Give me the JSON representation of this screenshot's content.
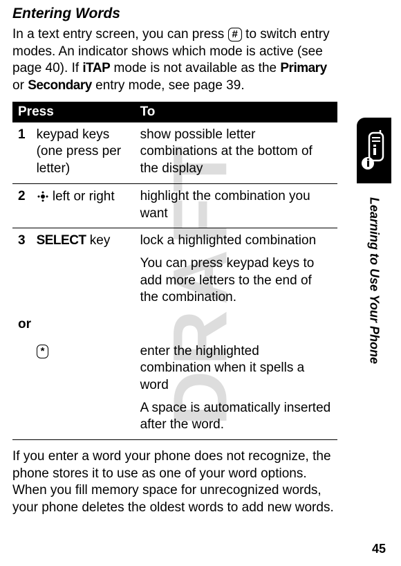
{
  "watermark": "DRAFT",
  "section_title": "Entering Words",
  "intro_pre": "In a text entry screen, you can press ",
  "key_hash": "#",
  "intro_mid": " to switch entry modes. An indicator shows which mode is active (see page 40). If ",
  "itap": "iTAP",
  "intro_mid2": " mode is not available as the ",
  "primary": "Primary",
  "intro_mid3": " or ",
  "secondary": "Secondary",
  "intro_end": " entry mode, see page 39.",
  "table": {
    "header_press": "Press",
    "header_to": "To",
    "rows": [
      {
        "num": "1",
        "press": "keypad keys (one press per letter)",
        "to": "show possible letter combinations at the bottom of the display"
      },
      {
        "num": "2",
        "press_suffix": " left or right",
        "to": "highlight the combination you want"
      }
    ],
    "row3": {
      "num": "3",
      "select_label": "SELECT",
      "press_suffix": " key",
      "to_1": "lock a highlighted combination",
      "to_2": "You can press keypad keys to add more letters to the end of the combination."
    },
    "or_label": "or",
    "row_star": {
      "key": "*",
      "to_1": "enter the highlighted combination when it spells a word",
      "to_2": "A space is automatically inserted after the word."
    }
  },
  "outro": "If you enter a word your phone does not recognize, the phone stores it to use as one of your word options. When you fill memory space for unrecognized words, your phone deletes the oldest words to add new words.",
  "side_label": "Learning to Use Your Phone",
  "page_number": "45"
}
